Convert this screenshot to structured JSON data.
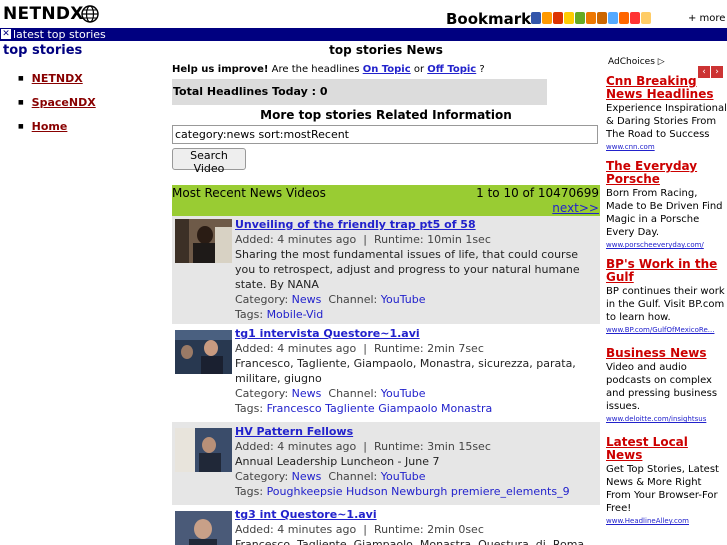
{
  "header": {
    "logo": "NETNDX",
    "bookmark_label": "Bookmark:",
    "more_label": "+ more",
    "bookmark_icon_colors": [
      "#3355aa",
      "#ff9900",
      "#dd3300",
      "#ffcc00",
      "#66aa22",
      "#ee7700",
      "#cc6600",
      "#55aaff",
      "#ff6600",
      "#ff3333",
      "#ffcc66"
    ]
  },
  "navbar": {
    "text": "latest top stories"
  },
  "sidebar": {
    "title": "top stories",
    "links": [
      "NETNDX",
      "SpaceNDX",
      "Home"
    ]
  },
  "main": {
    "title": "top stories News",
    "help_prefix": "Help us improve!",
    "help_mid": " Are the headlines ",
    "on_topic": "On Topic",
    "or_text": " or ",
    "off_topic": "Off Topic",
    "help_suffix": " ?",
    "total_headlines": "Total Headlines Today : 0",
    "related_title": "More top stories Related Information",
    "query_value": "category:news sort:mostRecent",
    "search_button": "Search Video",
    "videos_header": "Most Recent News Videos",
    "range": "1 to 10 of 10470699",
    "next": "next>>"
  },
  "videos": [
    {
      "title": "Unveiling of the friendly trap pt5 of 58",
      "added": "Added: 4 minutes ago",
      "runtime": "Runtime: 10min 1sec",
      "description": "Sharing the most fundamental issues of life, that could course you to retrospect, adjust and progress to your natural humane state. By NANA",
      "category_label": "Category:",
      "category": "News",
      "channel_label": "Channel:",
      "channel": "YouTube",
      "tags_label": "Tags:",
      "tags": "Mobile-Vid"
    },
    {
      "title": "tg1 intervista Questore~1.avi",
      "added": "Added: 4 minutes ago",
      "runtime": "Runtime: 2min 7sec",
      "description": "Francesco, Tagliente, Giampaolo, Monastra, sicurezza, parata, militare, giugno",
      "category_label": "Category:",
      "category": "News",
      "channel_label": "Channel:",
      "channel": "YouTube",
      "tags_label": "Tags:",
      "tags": "Francesco  Tagliente  Giampaolo  Monastra"
    },
    {
      "title": "HV Pattern Fellows",
      "added": "Added: 4 minutes ago",
      "runtime": "Runtime: 3min 15sec",
      "description": "Annual Leadership Luncheon - June 7",
      "category_label": "Category:",
      "category": "News",
      "channel_label": "Channel:",
      "channel": "YouTube",
      "tags_label": "Tags:",
      "tags": "Poughkeepsie  Hudson  Newburgh  premiere_elements_9"
    },
    {
      "title": "tg3 int Questore~1.avi",
      "added": "Added: 4 minutes ago",
      "runtime": "Runtime: 2min 0sec",
      "description": "Francesco, Tagliente, Giampaolo, Monastra, Questura, di, Roma"
    }
  ],
  "ads": {
    "adchoices": "AdChoices",
    "items": [
      {
        "headline": "Cnn Breaking News Headlines",
        "body": "Experience Inspirational & Daring Stories From The Road to Success",
        "url": "www.cnn.com"
      },
      {
        "headline": "The Everyday Porsche",
        "body": "Born From Racing, Made to Be Driven Find Magic in a Porsche Every Day.",
        "url": "www.porscheeveryday.com/"
      },
      {
        "headline": "BP's Work in the Gulf",
        "body": "BP continues their work in the Gulf. Visit BP.com to learn how.",
        "url": "www.BP.com/GulfOfMexicoRe..."
      },
      {
        "headline": "Business News",
        "body": "Video and audio podcasts on complex and pressing business issues.",
        "url": "www.deloitte.com/insightsus"
      },
      {
        "headline": "Latest Local News",
        "body": "Get Top Stories, Latest News & More Right From Your Browser-For Free!",
        "url": "www.HeadlineAlley.com"
      }
    ]
  }
}
